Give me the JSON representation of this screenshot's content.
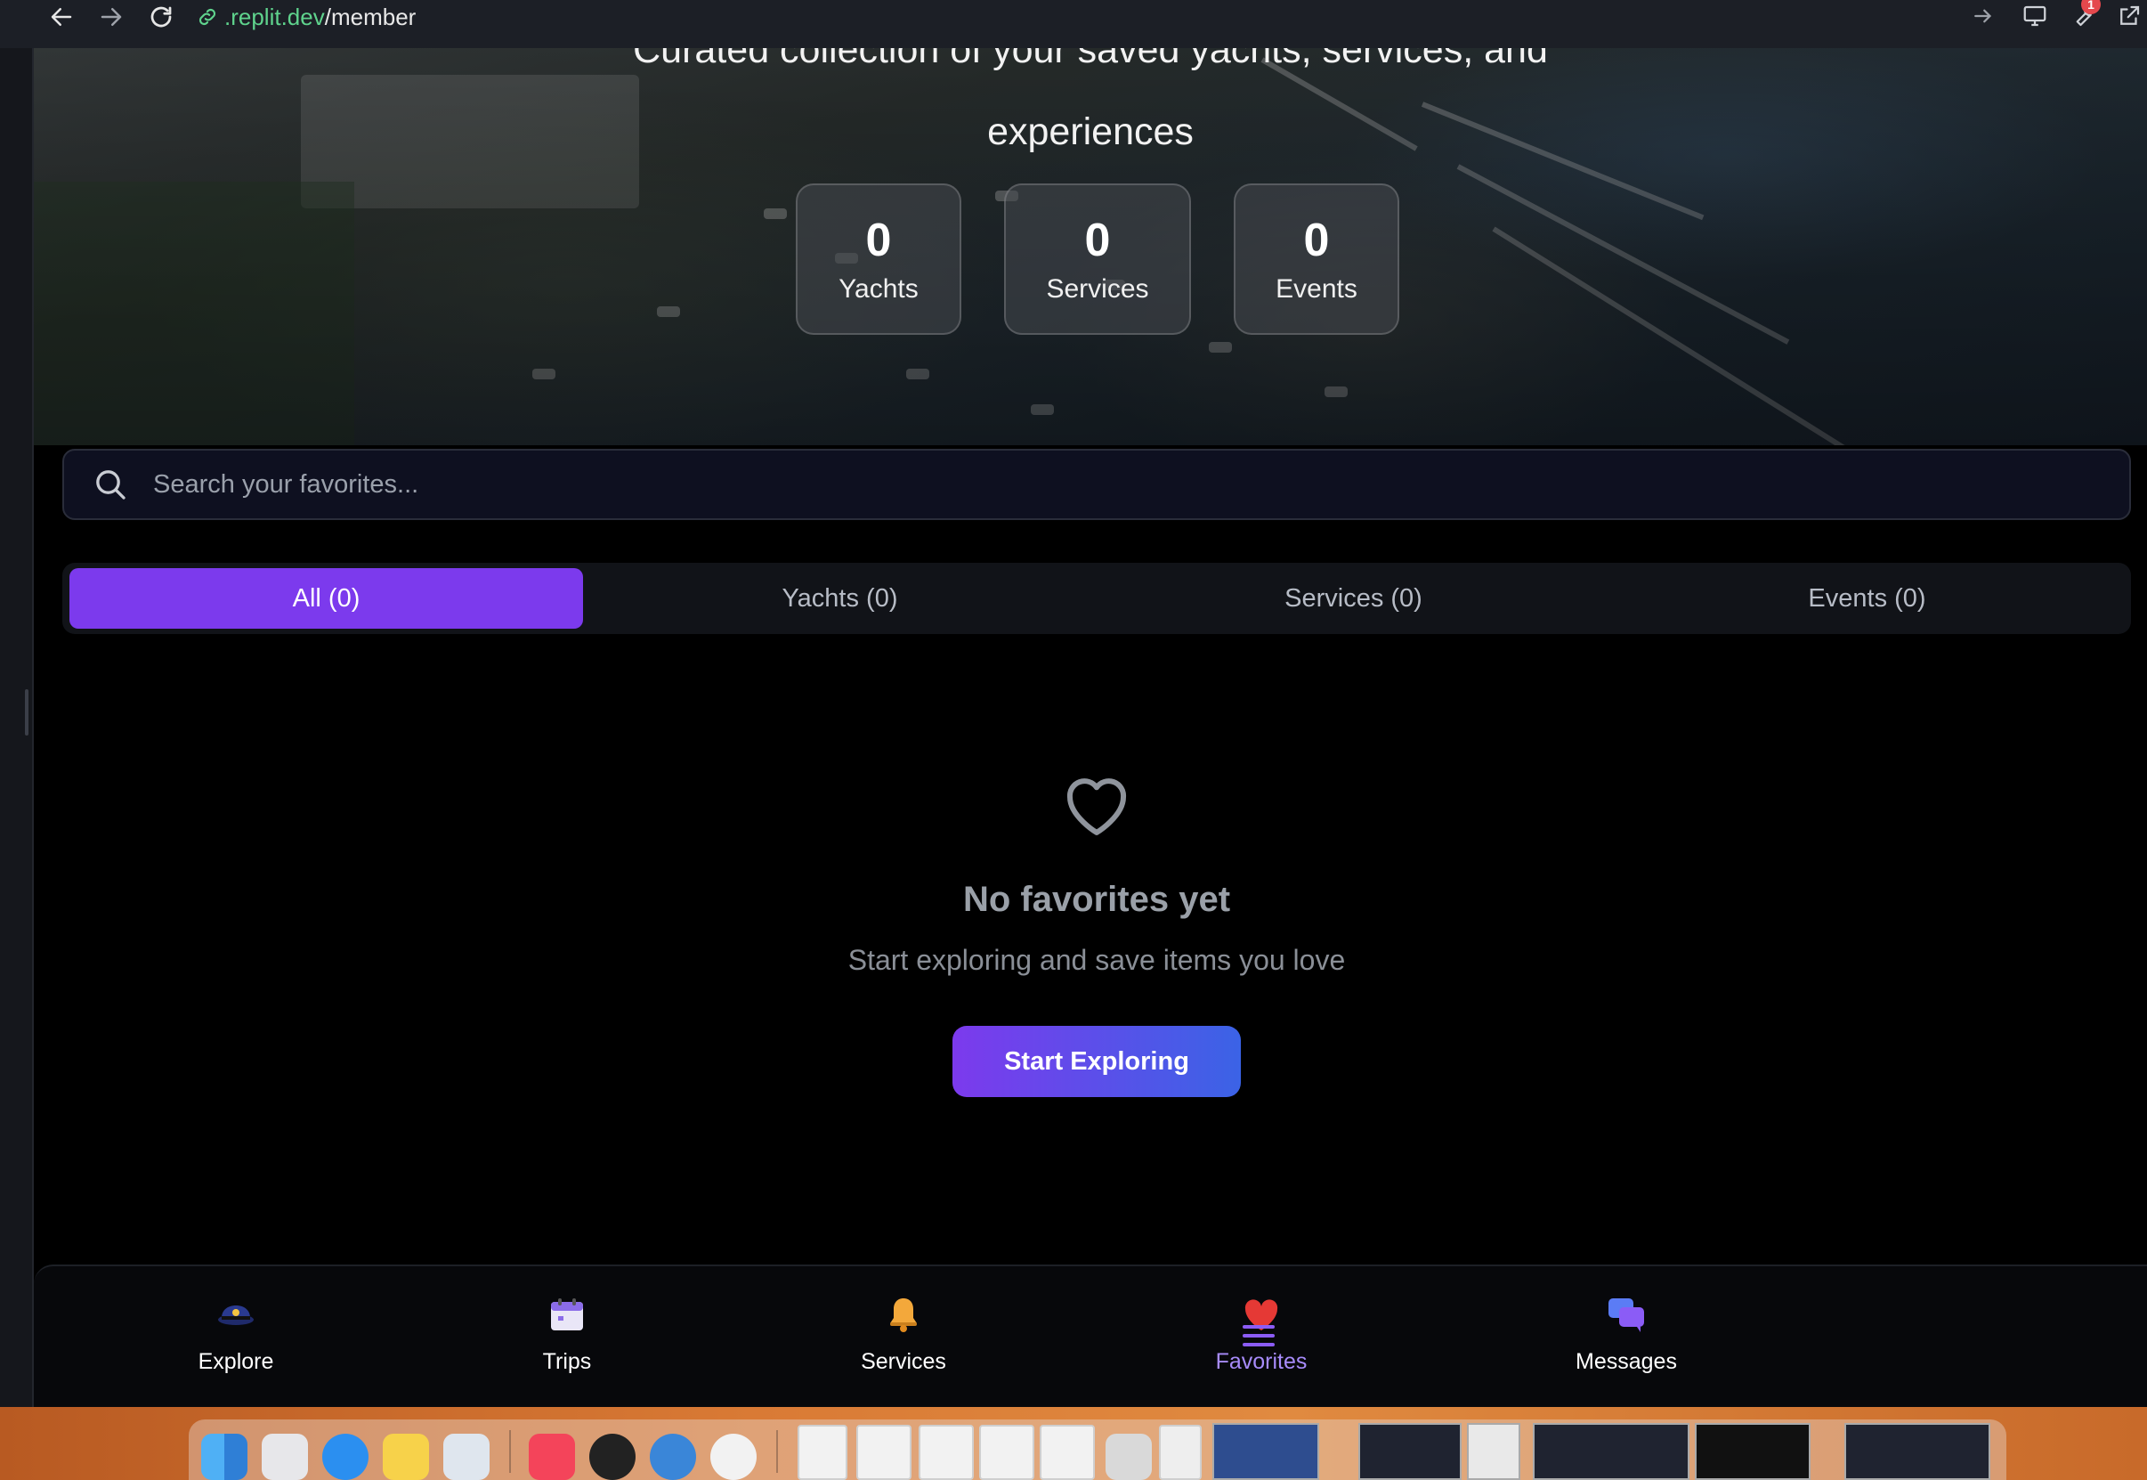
{
  "browser": {
    "url_host": ".replit.dev",
    "url_path": "/member",
    "notification_count": "1"
  },
  "hero": {
    "subtitle_line1": "Curated collection of your saved yachts, services, and",
    "subtitle_line2": "experiences",
    "stats": [
      {
        "value": "0",
        "label": "Yachts"
      },
      {
        "value": "0",
        "label": "Services"
      },
      {
        "value": "0",
        "label": "Events"
      }
    ]
  },
  "search": {
    "placeholder": "Search your favorites..."
  },
  "tabs": [
    {
      "label": "All (0)",
      "active": true
    },
    {
      "label": "Yachts (0)",
      "active": false
    },
    {
      "label": "Services (0)",
      "active": false
    },
    {
      "label": "Events (0)",
      "active": false
    }
  ],
  "empty_state": {
    "title": "No favorites yet",
    "subtitle": "Start exploring and save items you love",
    "button_label": "Start Exploring"
  },
  "bottom_nav": {
    "items": [
      {
        "label": "Explore",
        "icon": "captain-hat-icon"
      },
      {
        "label": "Trips",
        "icon": "calendar-icon"
      },
      {
        "label": "Services",
        "icon": "bell-icon"
      },
      {
        "label": "Favorites",
        "icon": "heart-icon",
        "active": true
      },
      {
        "label": "Messages",
        "icon": "chat-bubbles-icon"
      }
    ],
    "menu_icon": "hamburger-menu-icon"
  },
  "colors": {
    "accent": "#7c3aed",
    "accent_light": "#a78bfa",
    "cta_gradient_end": "#3b63e6",
    "url_host": "#5fd38d"
  }
}
